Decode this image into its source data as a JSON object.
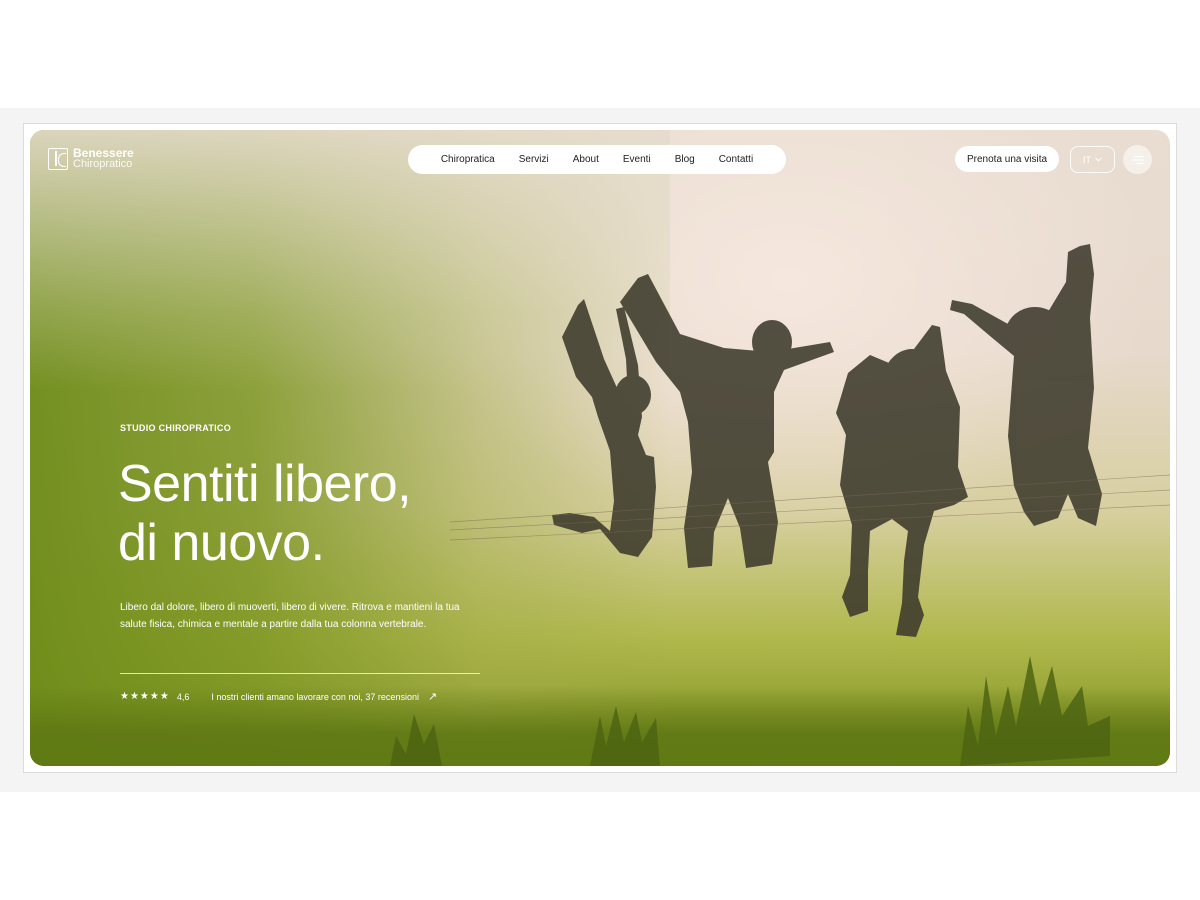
{
  "brand": {
    "name_line1": "Benessere",
    "name_line2": "Chiropratico"
  },
  "nav": {
    "items": [
      {
        "label": "Chiropratica"
      },
      {
        "label": "Servizi"
      },
      {
        "label": "About"
      },
      {
        "label": "Eventi"
      },
      {
        "label": "Blog"
      },
      {
        "label": "Contatti"
      }
    ]
  },
  "header": {
    "cta_label": "Prenota una visita",
    "language": "IT",
    "language_icon": "chevron-down-icon",
    "menu_icon": "menu-icon"
  },
  "hero": {
    "eyebrow": "STUDIO CHIROPRATICO",
    "headline_line1": "Sentiti libero,",
    "headline_line2": "di nuovo.",
    "intro": "Libero dal dolore, libero di muoverti, libero di vivere. Ritrova e mantieni la tua salute fisica, chimica e mentale a partire dalla tua colonna vertebrale.",
    "rating_stars": "★★★★★",
    "rating_value": "4,6",
    "rating_fraction": 0.92,
    "reviews_text": "I nostri clienti amano lavorare con noi, 37 recensioni",
    "reviews_icon": "arrow-up-right-icon"
  },
  "colors": {
    "hero_green": "#7d8f1f",
    "sky": "#e9ddd2",
    "silhouette": "#3d3a2c"
  }
}
